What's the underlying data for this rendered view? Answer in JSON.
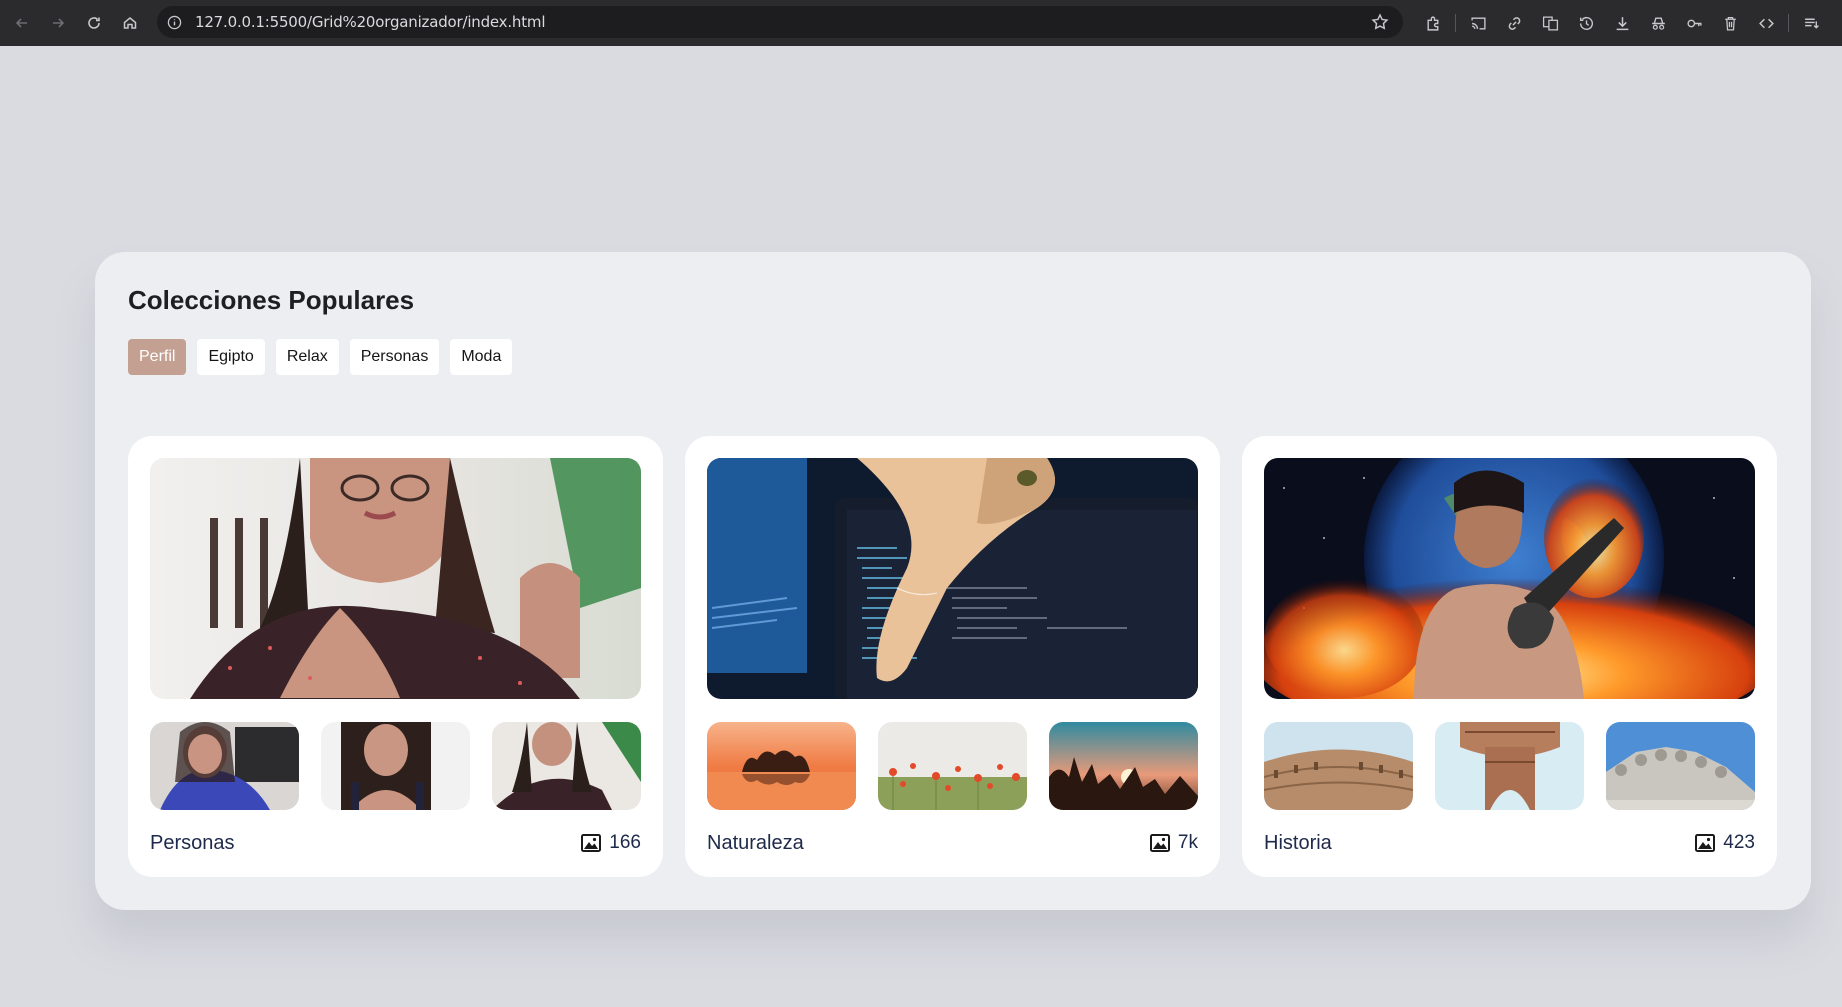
{
  "browser": {
    "url": "127.0.0.1:5500/Grid%20organizador/index.html"
  },
  "page": {
    "title": "Colecciones Populares",
    "filters": [
      "Perfil",
      "Egipto",
      "Relax",
      "Personas",
      "Moda"
    ],
    "active_filter": "Perfil"
  },
  "collections": [
    {
      "name": "Personas",
      "count": "166"
    },
    {
      "name": "Naturaleza",
      "count": "7k"
    },
    {
      "name": "Historia",
      "count": "423"
    }
  ],
  "colors": {
    "page_bg": "#d9dbe1",
    "panel_bg": "#eceef1",
    "active_chip": "#c3a092",
    "card_text": "#1e2a4a"
  },
  "icons": {
    "count": "image-icon"
  }
}
